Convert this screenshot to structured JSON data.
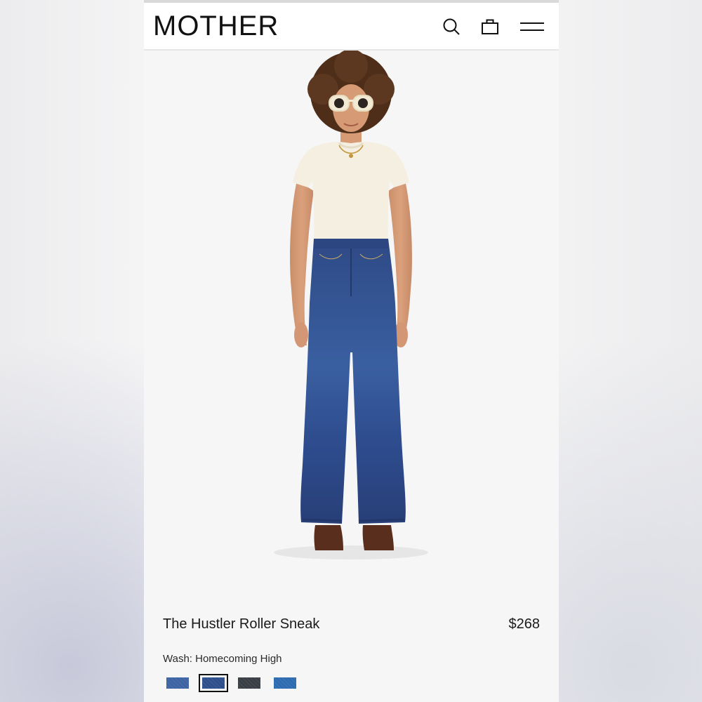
{
  "header": {
    "logo": "MOTHER",
    "icons": [
      "search-icon",
      "bag-icon",
      "menu-icon"
    ]
  },
  "product": {
    "name": "The Hustler Roller Sneak",
    "price": "$268",
    "wash_label": "Wash: Homecoming High",
    "swatches": [
      {
        "color": "#3d64a3",
        "selected": false
      },
      {
        "color": "#2f4f8c",
        "selected": true
      },
      {
        "color": "#3a3f46",
        "selected": false
      },
      {
        "color": "#2e6bb0",
        "selected": false
      }
    ]
  },
  "colors": {
    "background": "#f6f6f6",
    "text": "#1a1a1a",
    "denim": "#2f4a85",
    "tee": "#f4efe0"
  }
}
